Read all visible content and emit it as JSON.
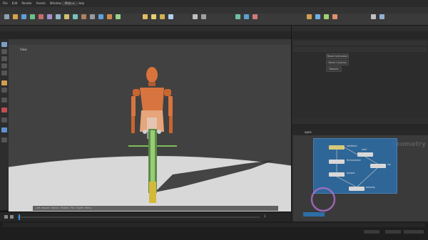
{
  "menu": {
    "file": "File",
    "edit": "Edit",
    "render": "Render",
    "assets": "Assets",
    "windows": "Windows",
    "labs": "Labs",
    "help": "Help"
  },
  "desktop": "Main",
  "viewport": {
    "label": "View"
  },
  "network": {
    "title": "Geometry",
    "path": "apex"
  },
  "parameters": {
    "buttons": [
      "Reset Animation",
      "Reset Controls",
      "Rebuild"
    ]
  },
  "nodes": [
    "skeleton",
    "skel",
    "fkcharacter",
    "rig",
    "output",
    "autorig"
  ],
  "timeline": {
    "frame": "1"
  },
  "status": {
    "hint": "Left mouse: Select. Middle: Pan. Right: Menu."
  }
}
